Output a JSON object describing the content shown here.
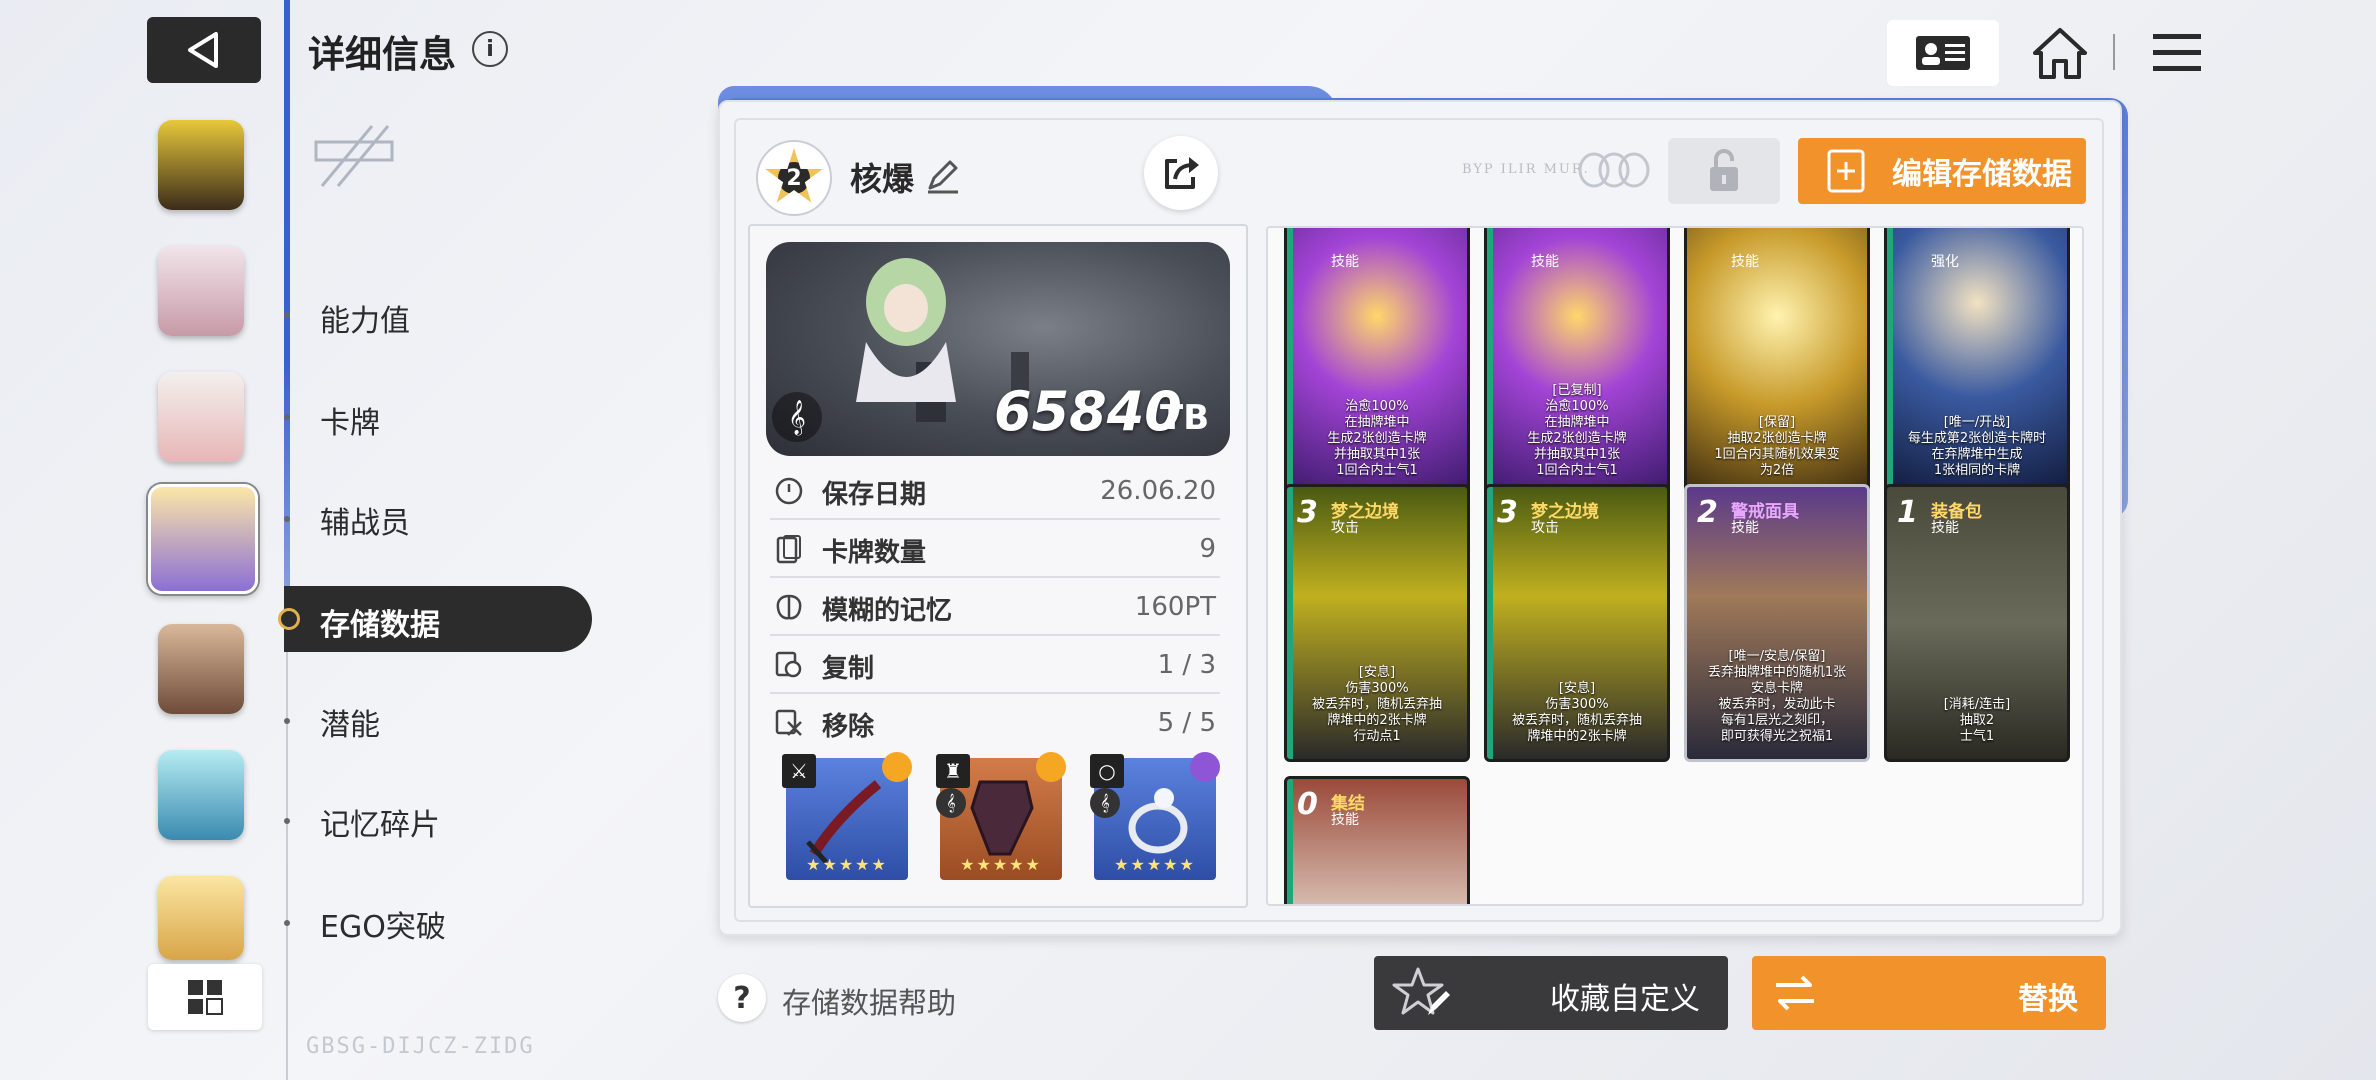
{
  "header": {
    "title": "详细信息",
    "info_label": "i"
  },
  "nav": {
    "items": [
      {
        "label": "能力值"
      },
      {
        "label": "卡牌"
      },
      {
        "label": "辅战员"
      },
      {
        "label": "存储数据",
        "active": true
      },
      {
        "label": "潜能"
      },
      {
        "label": "记忆碎片"
      },
      {
        "label": "EGO突破"
      }
    ]
  },
  "deck": {
    "level": "2",
    "name": "核爆",
    "score": "65840",
    "score_unit": "TB",
    "edit_label": "编辑存储数据"
  },
  "stats": [
    {
      "label": "保存日期",
      "value": "26.06.20",
      "icon": "clock-icon"
    },
    {
      "label": "卡牌数量",
      "value": "9",
      "icon": "cards-icon"
    },
    {
      "label": "模糊的记忆",
      "value": "160PT",
      "icon": "brain-icon"
    },
    {
      "label": "复制",
      "value": "1 / 3",
      "icon": "copy-icon"
    },
    {
      "label": "移除",
      "value": "5 / 5",
      "icon": "remove-icon"
    }
  ],
  "equipment": [
    {
      "type": "weapon",
      "stars": "★★★★★",
      "color": "#3c62c4",
      "gem_color": "#f5a623"
    },
    {
      "type": "armor",
      "stars": "★★★★★",
      "color": "#b8653a",
      "gem_color": "#f5a623"
    },
    {
      "type": "ring",
      "stars": "★★★★★",
      "color": "#3c62c4",
      "gem_color": "#8e55d6"
    }
  ],
  "cards": [
    {
      "cost": "",
      "name": "",
      "type": "技能",
      "desc": "治愈100%\n在抽牌堆中\n生成2张创造卡牌\n并抽取其中1张\n1回合内士气1",
      "bg": "#6a2fa0"
    },
    {
      "cost": "",
      "name": "",
      "type": "技能",
      "desc": "[已复制]\n治愈100%\n在抽牌堆中\n生成2张创造卡牌\n并抽取其中1张\n1回合内士气1",
      "bg": "#6a2fa0"
    },
    {
      "cost": "",
      "name": "",
      "type": "技能",
      "desc": "[保留]\n抽取2张创造卡牌\n1回合内其随机效果变\n为2倍",
      "bg": "#8a6a20"
    },
    {
      "cost": "",
      "name": "",
      "type": "强化",
      "desc": "[唯一/开战]\n每生成第2张创造卡牌时\n在弃牌堆中生成\n1张相同的卡牌",
      "bg": "#1f3e7a"
    },
    {
      "cost": "3",
      "name": "梦之边境",
      "type": "攻击",
      "desc": "[安息]\n伤害300%\n被丢弃时，随机丢弃抽\n牌堆中的2张卡牌\n行动点1",
      "bg": "#5a6a10"
    },
    {
      "cost": "3",
      "name": "梦之边境",
      "type": "攻击",
      "desc": "[安息]\n伤害300%\n被丢弃时，随机丢弃抽\n牌堆中的2张卡牌",
      "bg": "#5a6a10"
    },
    {
      "cost": "2",
      "name": "警戒面具",
      "type": "技能",
      "desc": "[唯一/安息/保留]\n丢弃抽牌堆中的随机1张\n安息卡牌\n被丢弃时，发动此卡\n每有1层光之刻印，\n即可获得光之祝福1",
      "bg": "#3a3a5a"
    },
    {
      "cost": "1",
      "name": "装备包",
      "type": "技能",
      "desc": "[消耗/连击]\n抽取2\n士气1",
      "bg": "#3a3a2e"
    },
    {
      "cost": "0",
      "name": "集结",
      "type": "技能",
      "desc": "",
      "bg": "#7a3b2e"
    }
  ],
  "footer": {
    "help_label": "存储数据帮助",
    "favorite_label": "收藏自定义",
    "swap_label": "替换"
  },
  "decor": {
    "bottom_code": "GBSG-DIJCZ-ZIDG",
    "faded_text": "BYP ILIR MUR."
  },
  "colors": {
    "accent_orange": "#f2922a",
    "accent_blue": "#3a5fcf",
    "dark": "#2c2c2c"
  }
}
